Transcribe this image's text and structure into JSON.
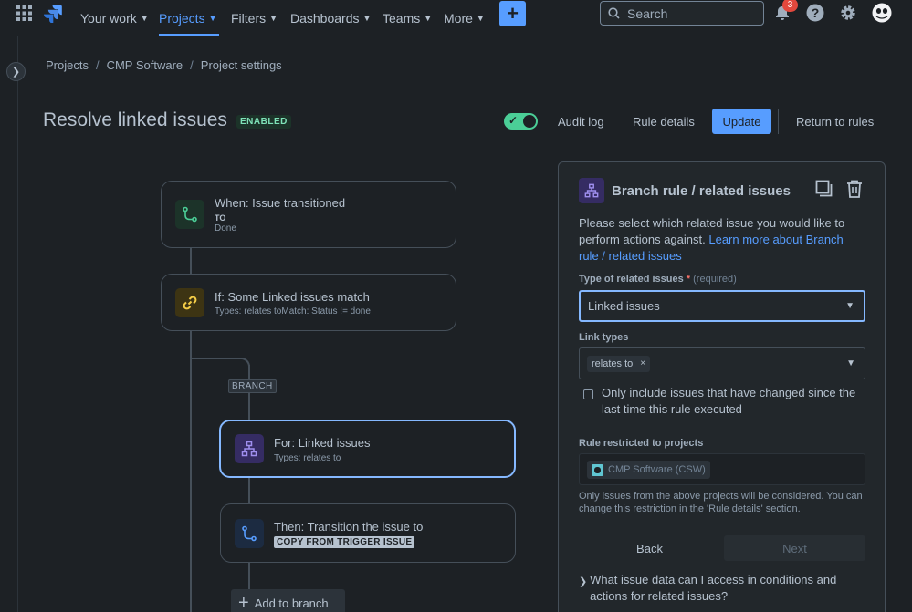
{
  "nav": {
    "your_work": "Your work",
    "projects": "Projects",
    "filters": "Filters",
    "dashboards": "Dashboards",
    "teams": "Teams",
    "more": "More",
    "create": "+",
    "search_placeholder": "Search",
    "notification_count": "3"
  },
  "breadcrumb": {
    "items": [
      "Projects",
      "CMP Software",
      "Project settings"
    ],
    "separator": "/"
  },
  "header": {
    "title": "Resolve linked issues",
    "status": "ENABLED",
    "toggle_on": true,
    "audit_log": "Audit log",
    "rule_details": "Rule details",
    "update": "Update",
    "return_to_rules": "Return to rules"
  },
  "flow": {
    "trigger": {
      "title": "When: Issue transitioned",
      "sub_label": "TO",
      "sub_value": "Done"
    },
    "condition": {
      "title": "If: Some Linked issues match",
      "detail": "Types: relates toMatch: Status != done"
    },
    "branch_label": "BRANCH",
    "branch": {
      "title": "For: Linked issues",
      "detail": "Types: relates to"
    },
    "action": {
      "title": "Then: Transition the issue to",
      "chip": "COPY FROM TRIGGER ISSUE"
    },
    "add_to_branch": "Add to branch"
  },
  "panel": {
    "title": "Branch rule / related issues",
    "desc_text": "Please select which related issue you would like to perform actions against. ",
    "desc_link": "Learn more about Branch rule / related issues",
    "type_label": "Type of related issues",
    "required_mark": "*",
    "required_text": "(required)",
    "type_value": "Linked issues",
    "link_types_label": "Link types",
    "link_type_tag": "relates to",
    "tag_remove": "×",
    "checkbox_label": "Only include issues that have changed since the last time this rule executed",
    "restricted_label": "Rule restricted to projects",
    "project_tag": "CMP Software (CSW)",
    "note": "Only issues from the above projects will be considered. You can change this restriction in the 'Rule details' section.",
    "back": "Back",
    "next": "Next",
    "faq": "What issue data can I access in conditions and actions for related issues?"
  },
  "colors": {
    "accent": "#579dff",
    "enabled": "#4bce97",
    "badge": "#e2483d"
  }
}
